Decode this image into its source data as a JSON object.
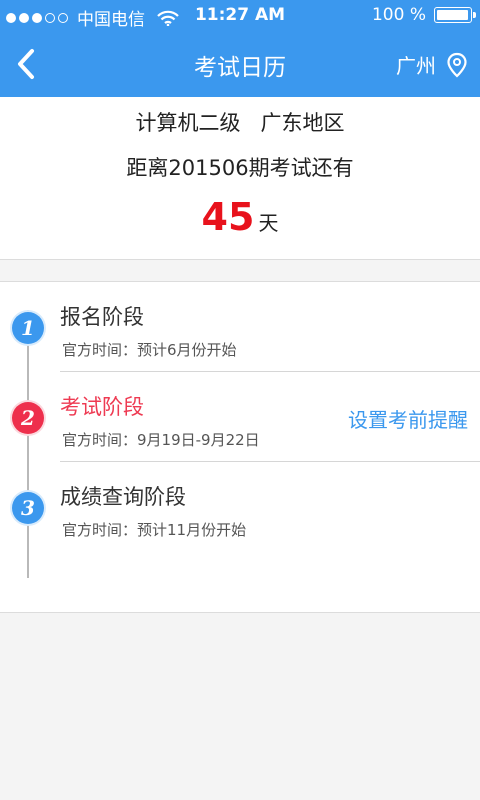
{
  "status_bar": {
    "carrier": "中国电信",
    "time": "11:27 AM",
    "battery": "100 %",
    "signal_strength": 3,
    "battery_level": 1.0
  },
  "nav": {
    "title": "考试日历",
    "city": "广州"
  },
  "countdown": {
    "exam": "计算机二级",
    "region": "广东地区",
    "period_text": "距离201506期考试还有",
    "days": "45",
    "days_unit": "天"
  },
  "stages": [
    {
      "number": "1",
      "name": "报名阶段",
      "time": "官方时间：预计6月份开始",
      "color": "#3b98ee"
    },
    {
      "number": "2",
      "name": "考试阶段",
      "time": "官方时间：9月19日-9月22日",
      "color": "#ee2f4c",
      "action": "设置考前提醒"
    },
    {
      "number": "3",
      "name": "成绩查询阶段",
      "time": "官方时间：预计11月份开始",
      "color": "#3b98ee"
    }
  ]
}
